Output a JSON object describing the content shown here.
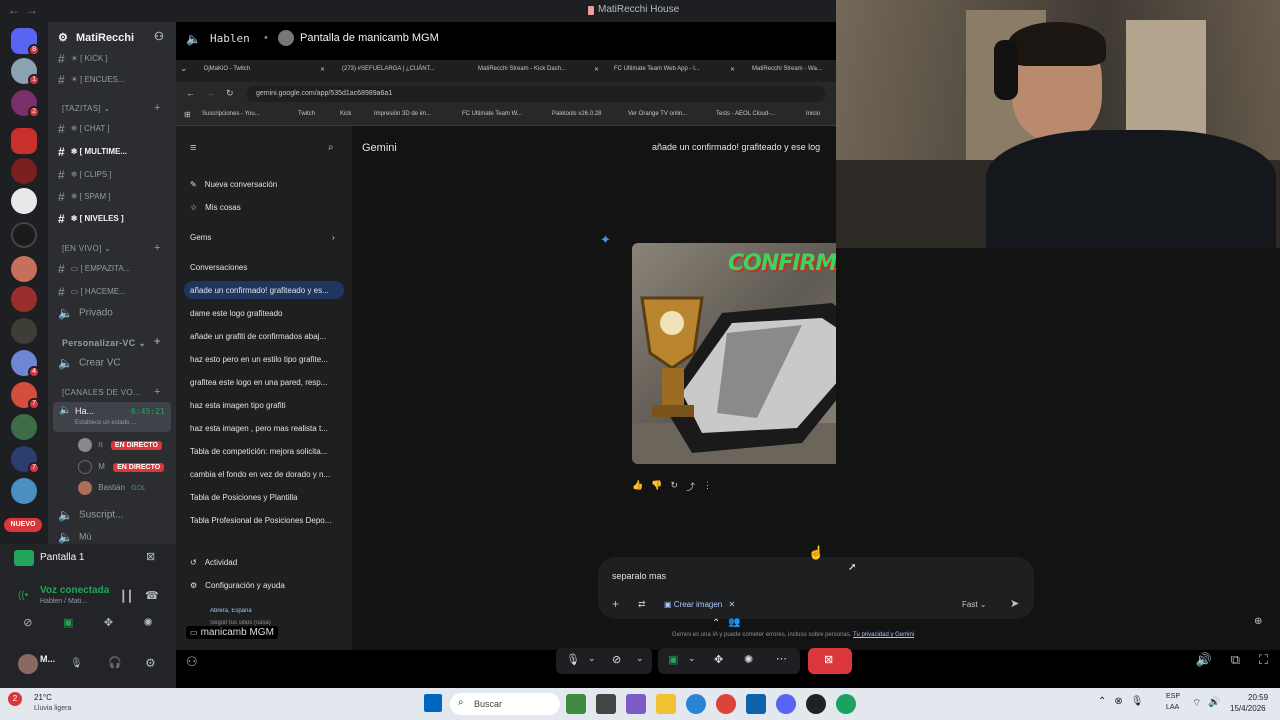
{
  "window": {
    "title": "MatiRecchi House"
  },
  "server": {
    "name": "MatiRecchi"
  },
  "channels": [
    {
      "label": "[ KICK ]"
    },
    {
      "label": "[ ENCUES..."
    },
    {
      "label": "[ CHAT ]"
    },
    {
      "label": "[ MULTIME..."
    },
    {
      "label": "[ CLIPS ]"
    },
    {
      "label": "[ SPAM ]"
    },
    {
      "label": "[ NIVELES ]"
    },
    {
      "label": "[ EMPAZITA..."
    },
    {
      "label": "[ HACEME..."
    },
    {
      "label": "Privado"
    }
  ],
  "categories": {
    "tazitas": "[TAZITAS]",
    "en_vivo": "[EN VIVO]",
    "personalizar": "Personalizar-VC",
    "canales_voz": "[CANALES DE VO..."
  },
  "voice": {
    "crear": "Crear VC",
    "active_channel": "Ha...",
    "timer": "6:45:21",
    "status": "Establece un estado ...",
    "members": [
      {
        "name": "n",
        "badge": "EN DIRECTO"
      },
      {
        "name": "M",
        "badge": "EN DIRECTO"
      },
      {
        "name": "Bastián",
        "badge": "GOL"
      }
    ],
    "suscript": "Suscript...",
    "last": "Mú"
  },
  "stream": {
    "label": "Pantalla 1",
    "connected": "Voz conectada",
    "sub": "Hablen / Mati..."
  },
  "user": {
    "name": "M..."
  },
  "nuevo_badge": "NUEVO",
  "header": {
    "channel": "Hablen",
    "screen_title": "Pantalla de manicamb MGM"
  },
  "browser": {
    "tabs": [
      "DjMaKiO - Twitch",
      "(273) #SEFUELARGA | ¿CUÁNT...",
      "MatiRecchi Stream - Kick Dash...",
      "FC Ultimate Team Web App - I...",
      "MatiRecchi Stream - Wa..."
    ],
    "url": "gemini.google.com/app/535d1ac68989a6a1",
    "bookmarks": [
      "Suscripciones - You...",
      "Twitch",
      "Kick",
      "Impresión 3D de im...",
      "FC Ultimate Team W...",
      "Paletools v26.0.28",
      "Ver Orange TV onlin...",
      "Tests - AEOL Cloud-...",
      "Inicio"
    ]
  },
  "gemini": {
    "brand": "Gemini",
    "title_bar": "añade un confirmado! grafiteado y ese log",
    "new_chat": "Nueva conversación",
    "my_stuff": "Mis cosas",
    "gems": "Gems",
    "conversations_label": "Conversaciones",
    "conversations": [
      "añade un confirmado! grafiteado y es...",
      "dame este logo grafiteado",
      "añade un grafiti de confirmados abaj...",
      "haz esto pero en un estilo tipo grafite...",
      "grafitea este logo en una pared, resp...",
      "haz esta imagen tipo grafiti",
      "haz esta imagen , pero mas realista t...",
      "Tabla de competición: mejora solicita...",
      "cambia el fondo en vez de dorado y n...",
      "Tabla de Posiciones y Plantilla",
      "Tabla Profesional de Posiciones Depo..."
    ],
    "activity": "Actividad",
    "settings": "Configuración y ayuda",
    "location": "Abrera, España",
    "location_sub": "Según tus sitios (casa)",
    "image_text": "CONFIRMADO!",
    "prompt_value": "separalo mas",
    "create_image": "Crear imagen",
    "model": "Fast",
    "disclaimer": "Gemini es una IA y puede cometer errores, incluso sobre personas.",
    "privacy_link": "Tu privacidad y Gemini"
  },
  "streamer_label": "manicamb MGM",
  "taskbar": {
    "weather_temp": "21°C",
    "weather_desc": "Lluvia ligera",
    "search": "Buscar",
    "lang": "ESP",
    "lang2": "LAA",
    "time": "20:59",
    "date": "15/4/2026"
  },
  "colors": {
    "discord_bg": "#2b2d31",
    "accent_red": "#da373c",
    "gemini_bg": "#131314",
    "voice_green": "#23a55a"
  }
}
